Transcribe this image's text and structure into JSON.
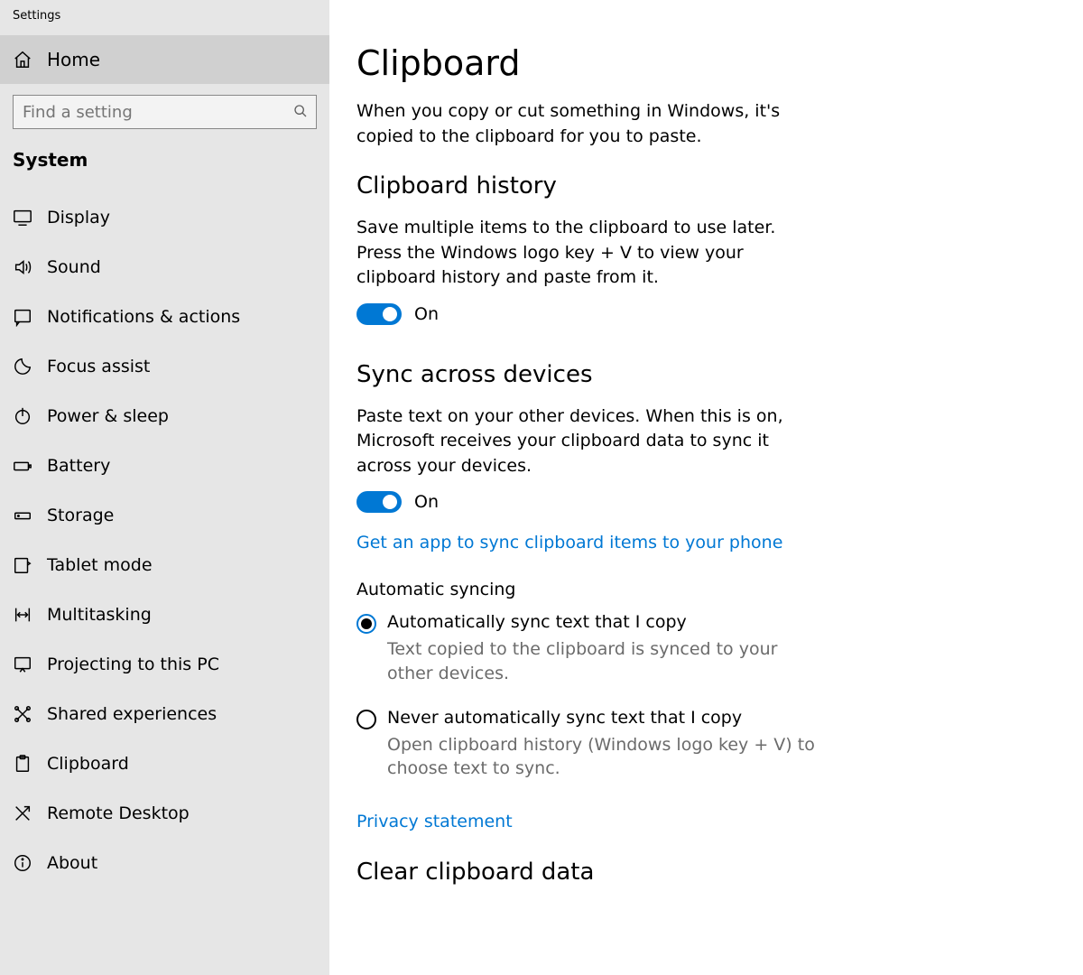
{
  "app_title": "Settings",
  "home_label": "Home",
  "search_placeholder": "Find a setting",
  "category": "System",
  "nav": [
    {
      "label": "Display"
    },
    {
      "label": "Sound"
    },
    {
      "label": "Notifications & actions"
    },
    {
      "label": "Focus assist"
    },
    {
      "label": "Power & sleep"
    },
    {
      "label": "Battery"
    },
    {
      "label": "Storage"
    },
    {
      "label": "Tablet mode"
    },
    {
      "label": "Multitasking"
    },
    {
      "label": "Projecting to this PC"
    },
    {
      "label": "Shared experiences"
    },
    {
      "label": "Clipboard"
    },
    {
      "label": "Remote Desktop"
    },
    {
      "label": "About"
    }
  ],
  "main": {
    "page_title": "Clipboard",
    "intro": "When you copy or cut something in Windows, it's copied to the clipboard for you to paste.",
    "history": {
      "title": "Clipboard history",
      "desc": "Save multiple items to the clipboard to use later. Press the Windows logo key + V to view your clipboard history and paste from it.",
      "toggle_state": "On"
    },
    "sync": {
      "title": "Sync across devices",
      "desc": "Paste text on your other devices. When this is on, Microsoft receives your clipboard data to sync it across your devices.",
      "toggle_state": "On",
      "link": "Get an app to sync clipboard items to your phone",
      "auto_heading": "Automatic syncing",
      "options": [
        {
          "label": "Automatically sync text that I copy",
          "desc": "Text copied to the clipboard is synced to your other devices.",
          "selected": true
        },
        {
          "label": "Never automatically sync text that I copy",
          "desc": "Open clipboard history (Windows logo key + V) to choose text to sync.",
          "selected": false
        }
      ],
      "privacy": "Privacy statement"
    },
    "clear": {
      "title": "Clear clipboard data"
    }
  }
}
